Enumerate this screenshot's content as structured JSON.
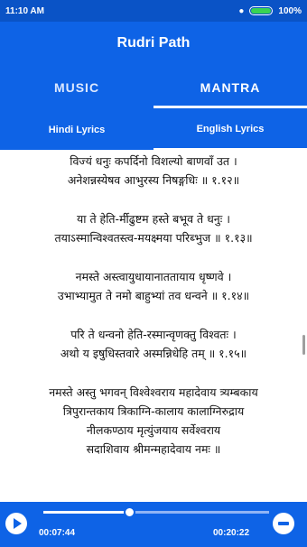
{
  "status": {
    "time": "11:10 AM",
    "battery": "100%"
  },
  "app": {
    "title": "Rudri Path"
  },
  "tabs": [
    {
      "label": "MUSIC",
      "active": false
    },
    {
      "label": "MANTRA",
      "active": true
    }
  ],
  "subtabs": [
    {
      "label": "Hindi Lyrics",
      "active": false
    },
    {
      "label": "English Lyrics",
      "active": true
    }
  ],
  "lyrics": {
    "verses": [
      [
        "विज्यं धनुः कपर्दिनो विशल्यो बाणवाँ उत ।",
        "अनेशन्नस्येषव आभुरस्य निषङ्गधिः ॥ १.१२॥"
      ],
      [
        "या ते हेति-र्मीढुष्टम हस्ते बभूव ते धनुः ।",
        "तयाऽस्मान्विश्वतस्त्व-मयक्ष्मया परिब्भुज ॥ १.१३॥"
      ],
      [
        "नमस्ते अस्त्वायुधायानाततायाय धृष्णवे ।",
        "उभाभ्यामुत ते नमो बाहुभ्यां तव धन्वने ॥ १.१४॥"
      ],
      [
        "परि ते धन्वनो हेति-रस्मान्वृणक्तु विश्वतः ।",
        "अथो य इषुधिस्तवारे अस्मन्निधेहि तम् ॥ १.१५॥"
      ],
      [
        "नमस्ते अस्तु भगवन् विश्वेश्वराय महादेवाय त्र्यम्बकाय",
        "त्रिपुरान्तकाय त्रिकाग्नि-कालाय कालाग्निरुद्राय",
        "नीलकण्ठाय मृत्युंजयाय सर्वेश्वराय",
        "सदाशिवाय श्रीमन्महादेवाय नमः ॥"
      ]
    ]
  },
  "player": {
    "current_time": "00:07:44",
    "total_time": "00:20:22",
    "progress": 0.38
  }
}
